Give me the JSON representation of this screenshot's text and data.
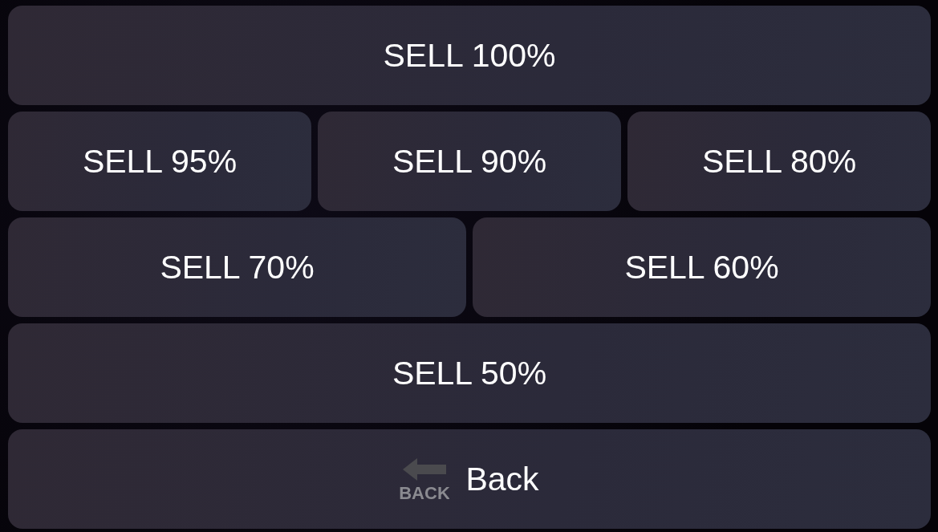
{
  "keyboard": {
    "rows": [
      {
        "buttons": [
          {
            "label": "SELL 100%"
          }
        ]
      },
      {
        "buttons": [
          {
            "label": "SELL 95%"
          },
          {
            "label": "SELL 90%"
          },
          {
            "label": "SELL 80%"
          }
        ]
      },
      {
        "buttons": [
          {
            "label": "SELL 70%"
          },
          {
            "label": "SELL 60%"
          }
        ]
      },
      {
        "buttons": [
          {
            "label": "SELL 50%"
          }
        ]
      },
      {
        "buttons": [
          {
            "label": "Back",
            "kind": "back",
            "icon_text": "BACK"
          }
        ]
      }
    ]
  }
}
